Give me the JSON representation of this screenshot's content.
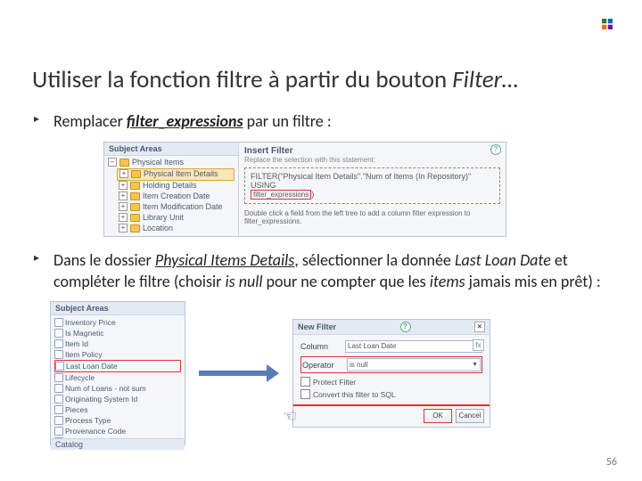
{
  "pagenum": "56",
  "title_main": "Utiliser la fonction filtre à partir du bouton ",
  "title_italic": "Filter…",
  "bullet1": {
    "pre": "Remplacer ",
    "em": "filter_expressions",
    "post": " par un filtre :"
  },
  "bullet2": {
    "t1": "Dans le dossier ",
    "em1": "Physical Items Details",
    "t2": ", sélectionner la donnée ",
    "em2": "Last Loan Date",
    "t3": " et compléter le filtre (choisir ",
    "em3": "is null",
    "t4": " pour ne compter que les ",
    "em4": "items",
    "t5": " jamais mis en prêt) :"
  },
  "panel1": {
    "tree_header": "Subject Areas",
    "root": "Physical Items",
    "items": [
      "Physical Item Details",
      "Holding Details",
      "Item Creation Date",
      "Item Modification Date",
      "Library Unit",
      "Location"
    ],
    "right_header": "Insert Filter",
    "right_intro": "Replace the selection with this statement:",
    "filter_line_pre": "FILTER(\"Physical Item Details\".\"Num of Items (In Repository)\" USING",
    "filter_expr_box": "filter_expressions",
    "filter_close": ")",
    "right_note": "Double click a field from the left tree to add a column filter expression to filter_expressions."
  },
  "panel2": {
    "header": "Subject Areas",
    "catalog": "Catalog",
    "cols": [
      "Inventory Price",
      "Is Magnetic",
      "Item Id",
      "Item Policy",
      "Last Loan Date",
      "Lifecycle",
      "Num of Loans - not sum",
      "Originating System Id",
      "Pieces",
      "Process Type",
      "Provenance Code",
      "…"
    ],
    "highlight_index": 4
  },
  "dialog": {
    "title": "New Filter",
    "column_label": "Column",
    "column_value": "Last Loan Date",
    "operator_label": "Operator",
    "operator_value": "is null",
    "protect": "Protect Filter",
    "convert": "Convert this filter to SQL",
    "ok": "OK",
    "cancel": "Cancel"
  }
}
